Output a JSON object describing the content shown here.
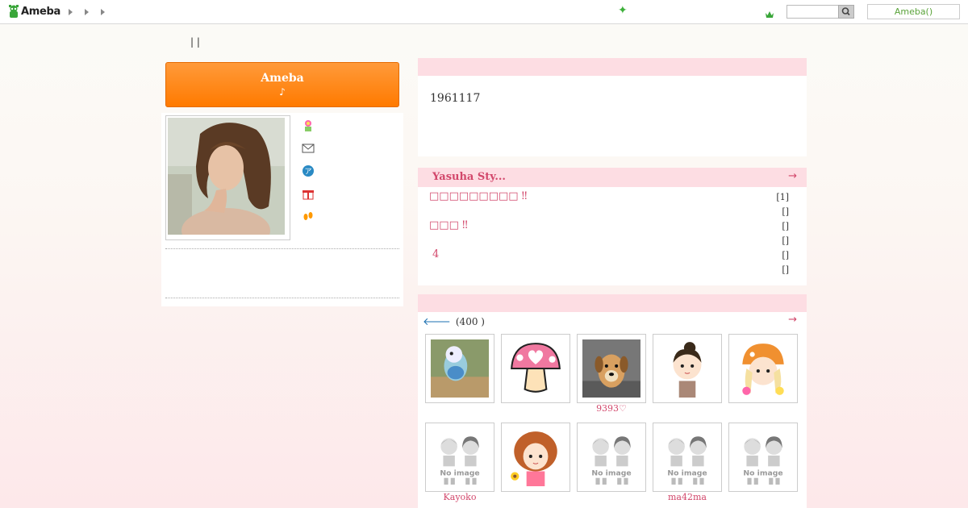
{
  "topbar": {
    "logo": "Ameba",
    "ameba_button": "Ameba()",
    "search_placeholder": ""
  },
  "nav": {
    "links": "|  |"
  },
  "orange_button": {
    "title": "Ameba",
    "subtitle": "♪"
  },
  "profile": {
    "icons": [
      "flower-icon",
      "mail-icon",
      "pigg-icon",
      "gift-icon",
      "footprint-icon"
    ]
  },
  "intro": {
    "text": "1961117"
  },
  "blog": {
    "title": "Yasuha Sty...",
    "arrow": "→",
    "entries": [
      "□□□□□□□□□ ‼",
      "□□□ ‼",
      "4"
    ],
    "counts": [
      "[1]",
      "[]",
      "[]",
      "[]",
      "[]",
      "[]"
    ]
  },
  "friends": {
    "count_label": "(400 )",
    "arrow": "→",
    "back": "🡐",
    "items": [
      {
        "caption": "",
        "kind": "bird"
      },
      {
        "caption": "",
        "kind": "mushroom"
      },
      {
        "caption": "9393♡",
        "kind": "dog"
      },
      {
        "caption": "",
        "kind": "avatar-bun"
      },
      {
        "caption": "",
        "kind": "avatar-cat"
      },
      {
        "caption": "Kayoko",
        "kind": "noimage"
      },
      {
        "caption": "",
        "kind": "avatar-curly"
      },
      {
        "caption": "",
        "kind": "noimage"
      },
      {
        "caption": "ma42ma",
        "kind": "noimage"
      },
      {
        "caption": "",
        "kind": "noimage"
      }
    ],
    "noimage_text": "No image"
  },
  "colors": {
    "accent": "#d2476b",
    "orange": "#ff7a00",
    "pink_header": "#fddde3"
  }
}
